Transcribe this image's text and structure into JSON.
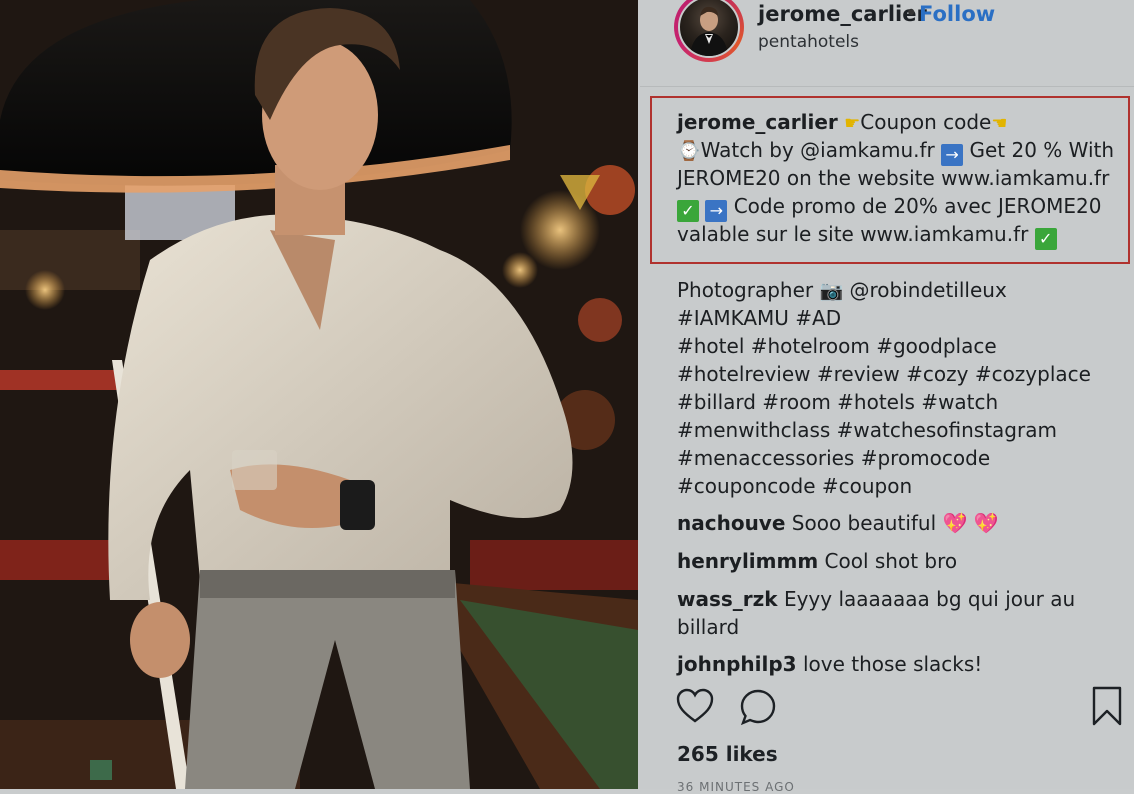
{
  "post": {
    "username": "jerome_carlier",
    "separator": "•",
    "follow_label": "Follow",
    "location": "pentahotels"
  },
  "caption": {
    "author": "jerome_carlier",
    "line1_text": "Coupon code",
    "line2_a": "Watch by @iamkamu.fr",
    "line2_b": "Get 20 % With",
    "line3": "JEROME20 on the website www.iamkamu.fr",
    "line4_b": "Code promo de 20% avec JEROME20",
    "line5": "valable sur le site www.iamkamu.fr",
    "arrow_glyph": "→",
    "check_glyph": "✓"
  },
  "tags": {
    "photographer_label": "Photographer",
    "photographer_handle": "@robindetilleux",
    "line1": "#IAMKAMU #AD",
    "line2": "#hotel #hotelroom #goodplace",
    "line3": "#hotelreview #review #cozy #cozyplace",
    "line4": "#billard #room #hotels #watch",
    "line5": "#menwithclass #watchesofinstagram",
    "line6": "#menaccessories #promocode",
    "line7": "#couponcode #coupon"
  },
  "comments": [
    {
      "user": "nachouve",
      "text": "Sooo beautiful"
    },
    {
      "user": "henrylimmm",
      "text": "Cool shot bro"
    },
    {
      "user": "wass_rzk",
      "text": "Eyyy laaaaaaa bg qui jour au",
      "text2": "billard"
    },
    {
      "user": "johnphilp3",
      "text": "love those slacks!"
    }
  ],
  "stats": {
    "likes": "265 likes",
    "timestamp": "36 MINUTES AGO"
  },
  "icons": {
    "like": "heart-icon",
    "comment": "comment-icon",
    "save": "bookmark-icon",
    "camera": "camera-icon",
    "watch": "watch-icon"
  },
  "colors": {
    "follow": "#2a6fc4",
    "highlight_border": "#b0322e",
    "panel_bg": "#c8cbcc"
  }
}
